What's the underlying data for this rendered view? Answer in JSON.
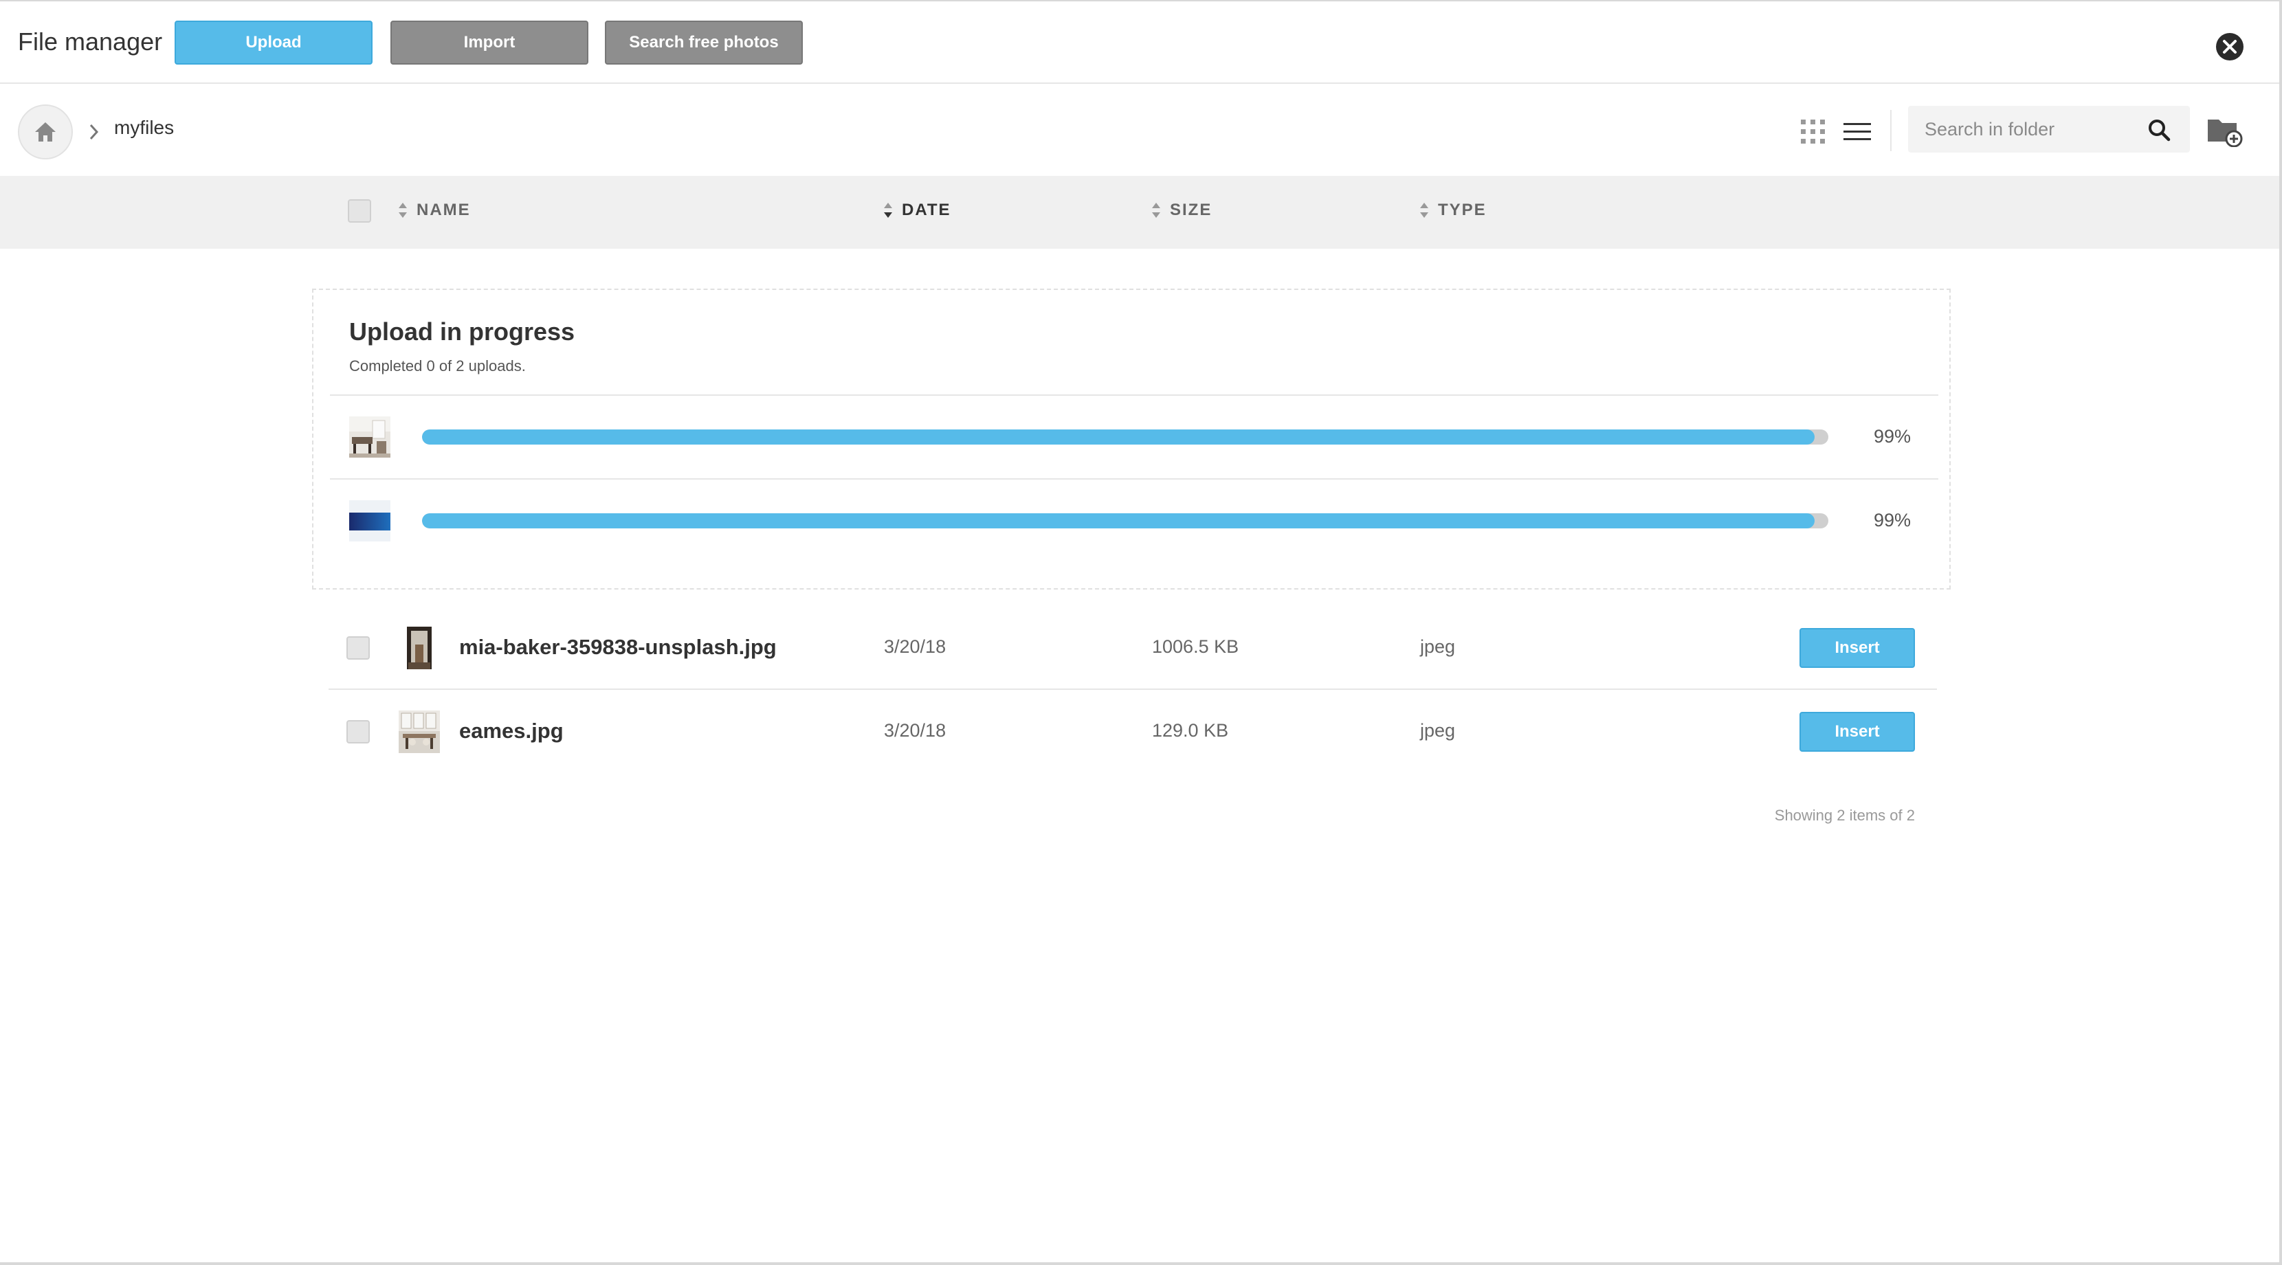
{
  "header": {
    "title": "File manager",
    "upload_label": "Upload",
    "import_label": "Import",
    "search_photos_label": "Search free photos"
  },
  "toolbar": {
    "breadcrumb": [
      "myfiles"
    ],
    "search_placeholder": "Search in folder"
  },
  "columns": {
    "name": "NAME",
    "date": "DATE",
    "size": "SIZE",
    "type": "TYPE",
    "sorted_by": "DATE"
  },
  "upload": {
    "title": "Upload in progress",
    "status": "Completed 0 of 2 uploads.",
    "items": [
      {
        "thumb": "interior-photo",
        "progress": 99,
        "progress_label": "99%"
      },
      {
        "thumb": "blue-gradient-image",
        "progress": 99,
        "progress_label": "99%"
      }
    ]
  },
  "files": [
    {
      "name": "mia-baker-359838-unsplash.jpg",
      "date": "3/20/18",
      "size": "1006.5 KB",
      "type": "jpeg",
      "action": "Insert"
    },
    {
      "name": "eames.jpg",
      "date": "3/20/18",
      "size": "129.0 KB",
      "type": "jpeg",
      "action": "Insert"
    }
  ],
  "footer": {
    "showing": "Showing 2 items of 2"
  },
  "colors": {
    "accent": "#56bbe9",
    "secondary_button": "#8e8e8e",
    "column_bar": "#f0f0f0"
  }
}
